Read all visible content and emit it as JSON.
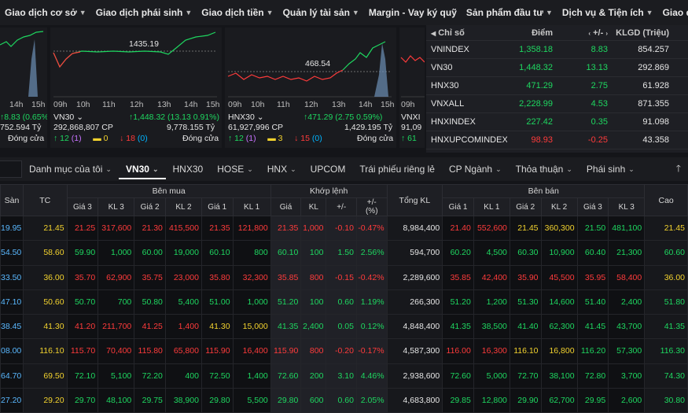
{
  "nav": {
    "items": [
      "Giao dịch cơ sở",
      "Giao dịch phái sinh",
      "Giao dịch tiền",
      "Quản lý tài sản",
      "Margin - Vay ký quỹ",
      "Sản phẩm đầu tư",
      "Dịch vụ & Tiện ích",
      "Giao diện"
    ]
  },
  "mini_charts": [
    {
      "times": [
        "14h",
        "15h"
      ],
      "change": "8.83 (0.65%)",
      "value": "752.594 Tỷ",
      "status": "Đóng cửa"
    },
    {
      "label": "VN30",
      "ref_label": "1435.19",
      "times": [
        "09h",
        "10h",
        "11h",
        "12h",
        "13h",
        "14h",
        "15h"
      ],
      "change": "1,448.32 (13.13 0.91%)",
      "volume": "292,868,807 CP",
      "value": "9,778.155 Tỷ",
      "up": "12",
      "up_paren": "(1)",
      "same": "0",
      "down": "18",
      "down_paren": "(0)",
      "status": "Đóng cửa"
    },
    {
      "label": "HNX30",
      "ref_label": "468.54",
      "times": [
        "09h",
        "10h",
        "11h",
        "12h",
        "13h",
        "14h",
        "15h"
      ],
      "change": "471.29 (2.75 0.59%)",
      "volume": "61,927,996 CP",
      "value": "1,429.195 Tỷ",
      "up": "12",
      "up_paren": "(1)",
      "same": "3",
      "down": "15",
      "down_paren": "(0)",
      "status": "Đóng cửa"
    },
    {
      "times": [
        "09h"
      ],
      "label": "VNXI",
      "volume": "91,09",
      "up": "61"
    }
  ],
  "index_table": {
    "headers": [
      "Chỉ số",
      "Điểm",
      "+/-",
      "KLGD (Triệu)"
    ],
    "rows": [
      {
        "name": "VNINDEX",
        "point": "1,358.18",
        "change": "8.83",
        "volume": "854.257",
        "color": "#1ed760"
      },
      {
        "name": "VN30",
        "point": "1,448.32",
        "change": "13.13",
        "volume": "292.869",
        "color": "#1ed760"
      },
      {
        "name": "HNX30",
        "point": "471.29",
        "change": "2.75",
        "volume": "61.928",
        "color": "#1ed760"
      },
      {
        "name": "VNXALL",
        "point": "2,228.99",
        "change": "4.53",
        "volume": "871.355",
        "color": "#1ed760"
      },
      {
        "name": "HNXINDEX",
        "point": "227.42",
        "change": "0.35",
        "volume": "91.098",
        "color": "#1ed760"
      },
      {
        "name": "HNXUPCOMINDEX",
        "point": "98.93",
        "change": "-0.25",
        "volume": "43.358",
        "color": "#ff3b3b"
      }
    ]
  },
  "filter_bar": {
    "items": [
      {
        "label": "Danh mục của tôi",
        "caret": true,
        "active": false
      },
      {
        "label": "VN30",
        "caret": true,
        "active": true
      },
      {
        "label": "HNX30",
        "caret": false,
        "active": false
      },
      {
        "label": "HOSE",
        "caret": true,
        "active": false
      },
      {
        "label": "HNX",
        "caret": true,
        "active": false
      },
      {
        "label": "UPCOM",
        "caret": false,
        "active": false
      },
      {
        "label": "Trái phiếu riêng lẻ",
        "caret": false,
        "active": false
      },
      {
        "label": "CP Ngành",
        "caret": true,
        "active": false
      },
      {
        "label": "Thỏa thuận",
        "caret": true,
        "active": false
      },
      {
        "label": "Phái sinh",
        "caret": true,
        "active": false
      }
    ]
  },
  "board": {
    "group_headers": {
      "san": "Sàn",
      "tc": "TC",
      "ben_mua": "Bên mua",
      "khop_lenh": "Khớp lệnh",
      "tong_kl": "Tổng KL",
      "ben_ban": "Bên bán",
      "cao": "Cao"
    },
    "sub_headers": {
      "buy": [
        "Giá 3",
        "KL 3",
        "Giá 2",
        "KL 2",
        "Giá 1",
        "KL 1"
      ],
      "match": [
        "Giá",
        "KL",
        "+/-",
        "+/-\n(%)"
      ],
      "sell": [
        "Giá 1",
        "KL 1",
        "Giá 2",
        "KL 2",
        "Giá 3",
        "KL 3"
      ]
    },
    "rows": [
      {
        "san": "19.95",
        "tc": "21.45",
        "b3p": "21.25",
        "b3v": "317,600",
        "b2p": "21.30",
        "b2v": "415,500",
        "b1p": "21.35",
        "b1v": "121,800",
        "mp": "21.35",
        "mv": "1,000",
        "ch": "-0.10",
        "chp": "-0.47%",
        "tot": "8,984,400",
        "s1p": "21.40",
        "s1v": "552,600",
        "s2p": "21.45",
        "s2v": "360,300",
        "s3p": "21.50",
        "s3v": "481,100",
        "cao": "21.45",
        "cols": {
          "b3": "red",
          "b2": "red",
          "b1": "red",
          "m": "red",
          "s1": "red",
          "s2": "yellow",
          "s3": "green",
          "cao": "yellow"
        }
      },
      {
        "san": "54.50",
        "tc": "58.60",
        "b3p": "59.90",
        "b3v": "1,000",
        "b2p": "60.00",
        "b2v": "19,000",
        "b1p": "60.10",
        "b1v": "800",
        "mp": "60.10",
        "mv": "100",
        "ch": "1.50",
        "chp": "2.56%",
        "tot": "594,700",
        "s1p": "60.20",
        "s1v": "4,500",
        "s2p": "60.30",
        "s2v": "10,900",
        "s3p": "60.40",
        "s3v": "21,300",
        "cao": "60.60",
        "cols": {
          "b3": "green",
          "b2": "green",
          "b1": "green",
          "m": "green",
          "s1": "green",
          "s2": "green",
          "s3": "green",
          "cao": "green"
        }
      },
      {
        "san": "33.50",
        "tc": "36.00",
        "b3p": "35.70",
        "b3v": "62,900",
        "b2p": "35.75",
        "b2v": "23,000",
        "b1p": "35.80",
        "b1v": "32,300",
        "mp": "35.85",
        "mv": "800",
        "ch": "-0.15",
        "chp": "-0.42%",
        "tot": "2,289,600",
        "s1p": "35.85",
        "s1v": "42,400",
        "s2p": "35.90",
        "s2v": "45,500",
        "s3p": "35.95",
        "s3v": "58,400",
        "cao": "36.00",
        "cols": {
          "b3": "red",
          "b2": "red",
          "b1": "red",
          "m": "red",
          "s1": "red",
          "s2": "red",
          "s3": "red",
          "cao": "yellow"
        }
      },
      {
        "san": "47.10",
        "tc": "50.60",
        "b3p": "50.70",
        "b3v": "700",
        "b2p": "50.80",
        "b2v": "5,400",
        "b1p": "51.00",
        "b1v": "1,000",
        "mp": "51.20",
        "mv": "100",
        "ch": "0.60",
        "chp": "1.19%",
        "tot": "266,300",
        "s1p": "51.20",
        "s1v": "1,200",
        "s2p": "51.30",
        "s2v": "14,600",
        "s3p": "51.40",
        "s3v": "2,400",
        "cao": "51.80",
        "cols": {
          "b3": "green",
          "b2": "green",
          "b1": "green",
          "m": "green",
          "s1": "green",
          "s2": "green",
          "s3": "green",
          "cao": "green"
        }
      },
      {
        "san": "38.45",
        "tc": "41.30",
        "b3p": "41.20",
        "b3v": "211,700",
        "b2p": "41.25",
        "b2v": "1,400",
        "b1p": "41.30",
        "b1v": "15,000",
        "mp": "41.35",
        "mv": "2,400",
        "ch": "0.05",
        "chp": "0.12%",
        "tot": "4,848,400",
        "s1p": "41.35",
        "s1v": "38,500",
        "s2p": "41.40",
        "s2v": "62,300",
        "s3p": "41.45",
        "s3v": "43,700",
        "cao": "41.35",
        "cols": {
          "b3": "red",
          "b2": "red",
          "b1": "yellow",
          "m": "green",
          "s1": "green",
          "s2": "green",
          "s3": "green",
          "cao": "green"
        }
      },
      {
        "san": "08.00",
        "tc": "116.10",
        "b3p": "115.70",
        "b3v": "70,400",
        "b2p": "115.80",
        "b2v": "65,800",
        "b1p": "115.90",
        "b1v": "16,400",
        "mp": "115.90",
        "mv": "800",
        "ch": "-0.20",
        "chp": "-0.17%",
        "tot": "4,587,300",
        "s1p": "116.00",
        "s1v": "16,300",
        "s2p": "116.10",
        "s2v": "16,800",
        "s3p": "116.20",
        "s3v": "57,300",
        "cao": "116.30",
        "cols": {
          "b3": "red",
          "b2": "red",
          "b1": "red",
          "m": "red",
          "s1": "red",
          "s2": "yellow",
          "s3": "green",
          "cao": "green"
        }
      },
      {
        "san": "64.70",
        "tc": "69.50",
        "b3p": "72.10",
        "b3v": "5,100",
        "b2p": "72.20",
        "b2v": "400",
        "b1p": "72.50",
        "b1v": "1,400",
        "mp": "72.60",
        "mv": "200",
        "ch": "3.10",
        "chp": "4.46%",
        "tot": "2,938,600",
        "s1p": "72.60",
        "s1v": "5,000",
        "s2p": "72.70",
        "s2v": "38,100",
        "s3p": "72.80",
        "s3v": "3,700",
        "cao": "74.30",
        "cols": {
          "b3": "green",
          "b2": "green",
          "b1": "green",
          "m": "green",
          "s1": "green",
          "s2": "green",
          "s3": "green",
          "cao": "green"
        }
      },
      {
        "san": "27.20",
        "tc": "29.20",
        "b3p": "29.70",
        "b3v": "48,100",
        "b2p": "29.75",
        "b2v": "38,900",
        "b1p": "29.80",
        "b1v": "5,500",
        "mp": "29.80",
        "mv": "600",
        "ch": "0.60",
        "chp": "2.05%",
        "tot": "4,683,800",
        "s1p": "29.85",
        "s1v": "12,800",
        "s2p": "29.90",
        "s2v": "62,700",
        "s3p": "29.95",
        "s3v": "2,600",
        "cao": "30.80",
        "cols": {
          "b3": "green",
          "b2": "green",
          "b1": "green",
          "m": "green",
          "s1": "green",
          "s2": "green",
          "s3": "green",
          "cao": "green"
        }
      }
    ]
  }
}
